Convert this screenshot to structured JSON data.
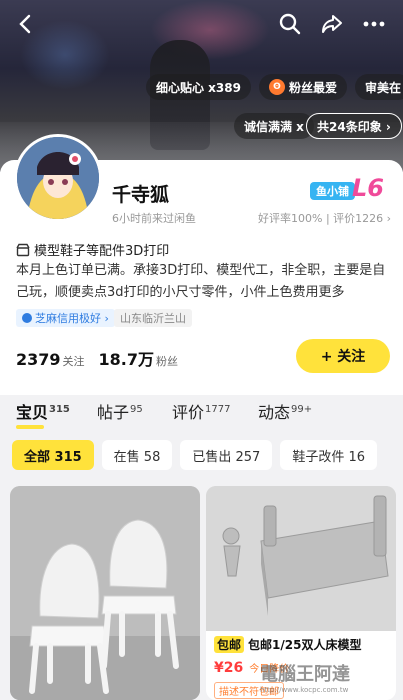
{
  "header": {
    "tags_row1": [
      "细心贴心 x389",
      "粉丝最爱",
      "审美在"
    ],
    "tags_row2": [
      "诚信满满 x",
      "共24条印象 ›"
    ]
  },
  "profile": {
    "name": "千寺狐",
    "last_active": "6小时前来过闲鱼",
    "shop_badge": "鱼小铺",
    "level": "L6",
    "rating": "好评率100% | 评价1226 ›",
    "bio_title": "模型鞋子等配件3D打印",
    "bio_text": "本月上色订单已满。承接3D打印、模型代工，非全职，主要是自己玩，顺便卖点3d打印的小尺寸零件，小件上色费用更多",
    "credit_tag": "芝麻信用极好 ›",
    "location": "山东临沂兰山",
    "stats": [
      {
        "value": "2379",
        "label": "关注"
      },
      {
        "value": "18.7万",
        "label": "粉丝"
      }
    ],
    "follow_label": "+ 关注"
  },
  "tabs": [
    {
      "label": "宝贝",
      "count": "315"
    },
    {
      "label": "帖子",
      "count": "95"
    },
    {
      "label": "评价",
      "count": "1777"
    },
    {
      "label": "动态",
      "count": "99+"
    }
  ],
  "chips": [
    "全部 315",
    "在售 58",
    "已售出 257",
    "鞋子改件 16"
  ],
  "products": {
    "right": {
      "badge": "包邮",
      "title": "包邮1/25双人床模型",
      "price": "¥26",
      "extra": "今日降价",
      "warning": "描述不符包邮"
    }
  },
  "watermark": {
    "text": "電腦王阿達",
    "url": "http://www.kocpc.com.tw"
  }
}
